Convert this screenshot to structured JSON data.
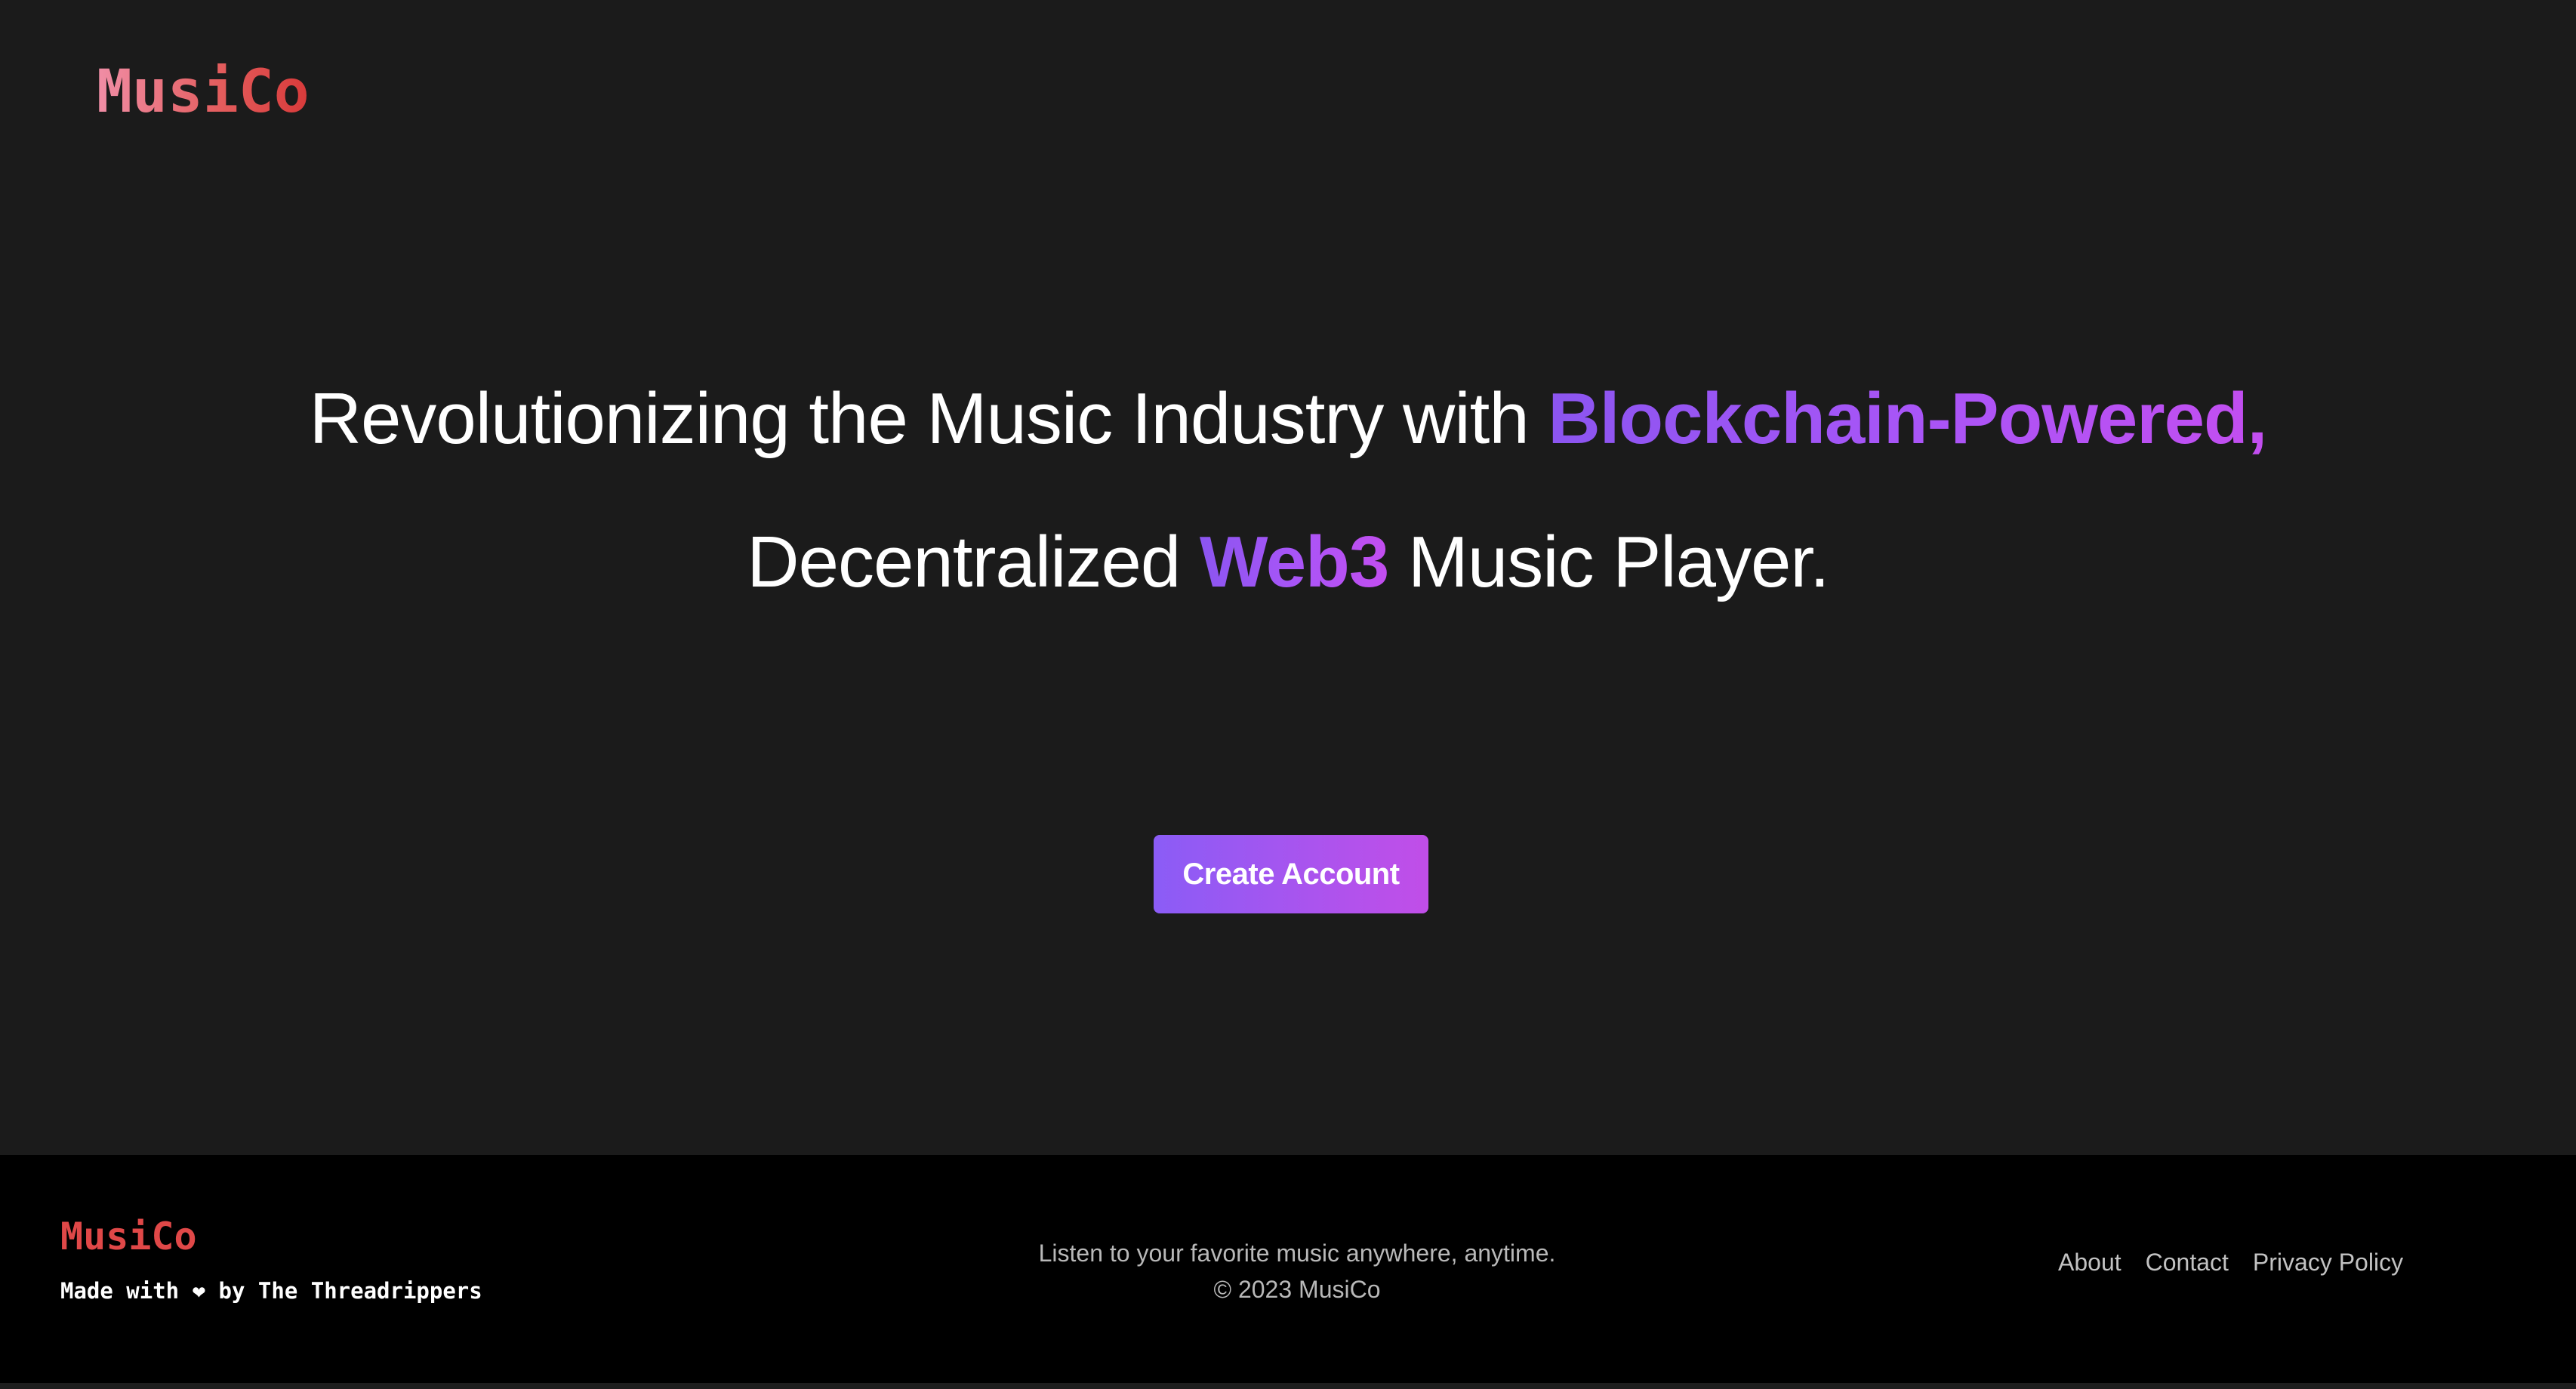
{
  "header": {
    "logo": "MusiCo"
  },
  "hero": {
    "line1_pre": "Revolutionizing the Music Industry with ",
    "line1_highlight": "Blockchain-Powered,",
    "line2_pre": "Decentralized ",
    "line2_highlight": "Web3",
    "line2_post": " Music Player.",
    "cta_label": "Create Account"
  },
  "footer": {
    "logo": "MusiCo",
    "made_with_prefix": "Made with ",
    "heart_icon": "heart-icon",
    "made_with_suffix": " by The Threadrippers",
    "tagline": "Listen to your favorite music anywhere, anytime.",
    "copyright": "© 2023 MusiCo",
    "links": [
      "About",
      "Contact",
      "Privacy Policy"
    ]
  },
  "colors": {
    "background": "#1b1b1b",
    "footer_background": "#000000",
    "accent_purple": "#8b5cf6",
    "accent_magenta": "#c14ee8",
    "logo_red": "#e04848"
  }
}
